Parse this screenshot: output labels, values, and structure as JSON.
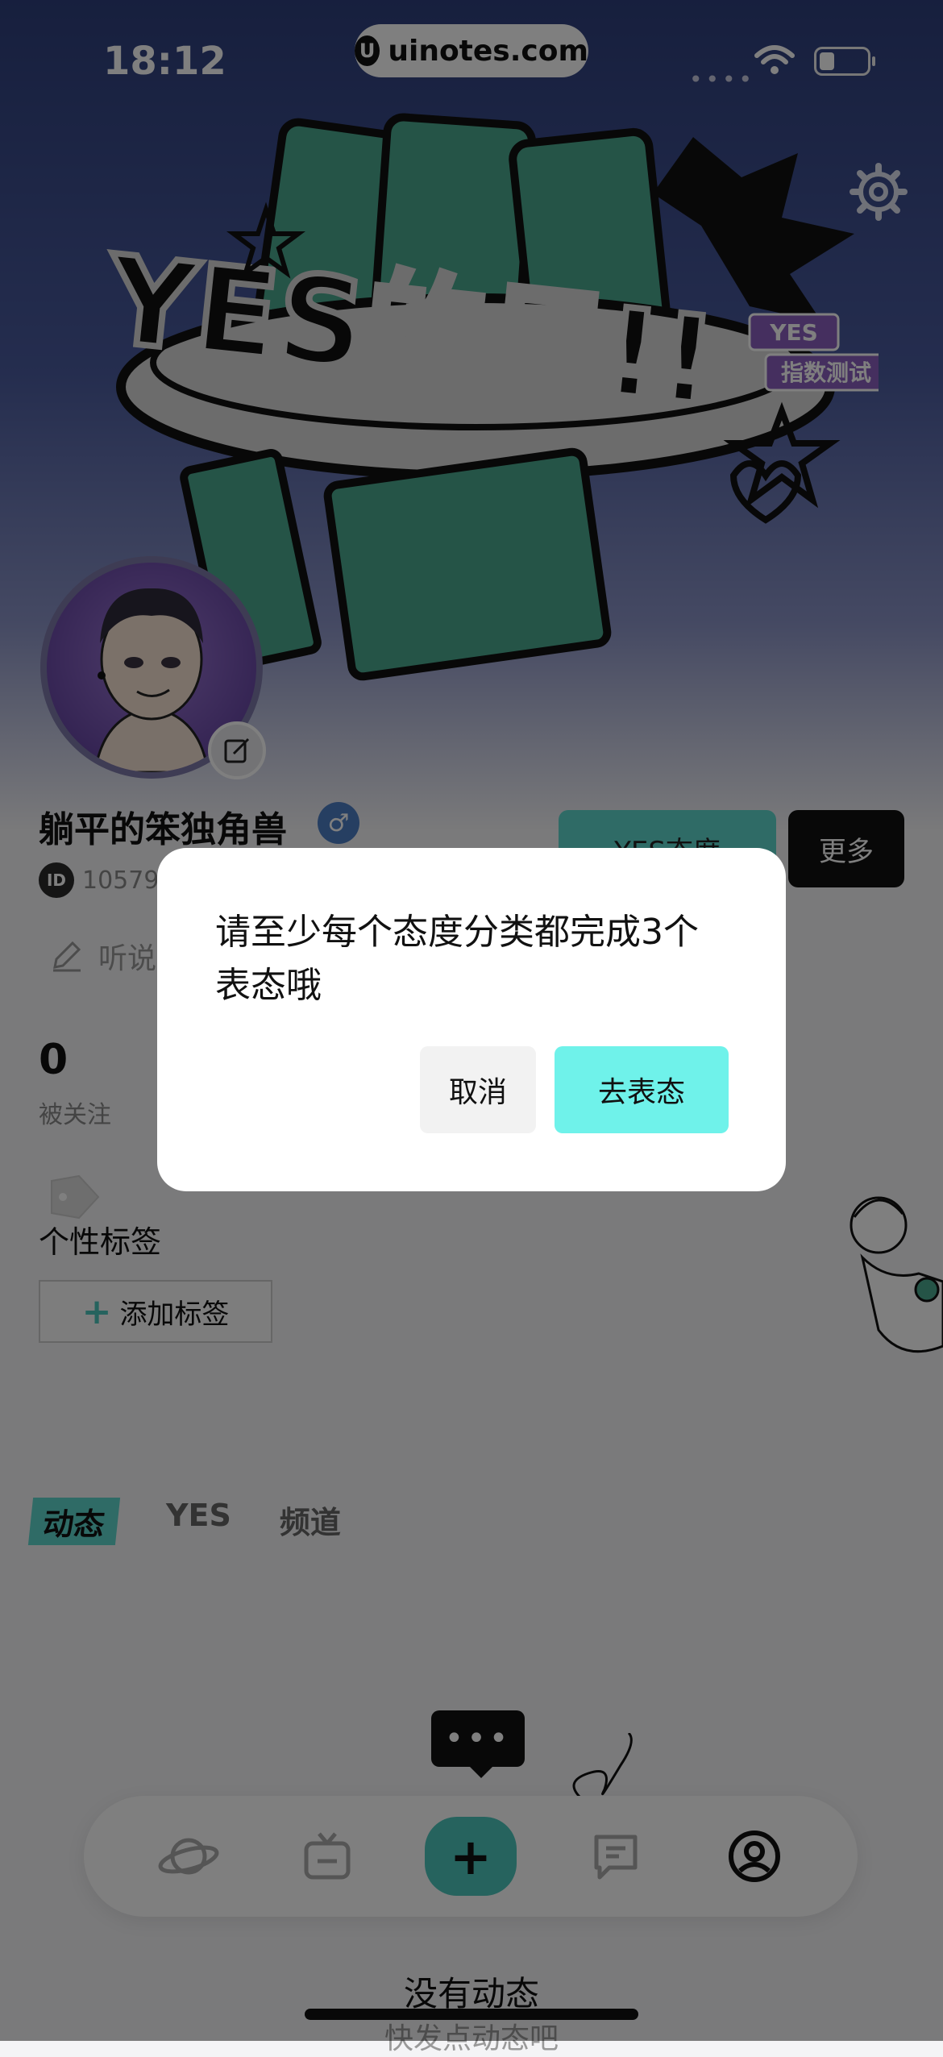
{
  "status_bar": {
    "time": "18:12",
    "url": "uinotes.com"
  },
  "sticker": {
    "main_text": "YES的尺!!",
    "badge_top": "YES",
    "badge_bottom": "指数测试"
  },
  "profile": {
    "name": "躺平的笨独角兽",
    "gender_symbol": "♂",
    "id_badge": "ID",
    "id_number": "10579",
    "bio_placeholder": "听说",
    "follower_count": "0",
    "follower_label": "被关注",
    "yes_button": "YES态度",
    "more_button": "更多"
  },
  "tags": {
    "title": "个性标签",
    "add_label": "添加标签"
  },
  "tabs": [
    {
      "label": "动态",
      "active": true
    },
    {
      "label": "YES",
      "active": false
    },
    {
      "label": "频道",
      "active": false
    }
  ],
  "chat_bubble": "•••",
  "empty": {
    "title": "没有动态",
    "subtitle": "快发点动态吧"
  },
  "nav": {
    "plus": "+",
    "items": [
      "planet-icon",
      "tv-icon",
      "add-icon",
      "message-icon",
      "profile-icon"
    ]
  },
  "dialog": {
    "message": "请至少每个态度分类都完成3个表态哦",
    "cancel": "取消",
    "confirm": "去表态"
  },
  "colors": {
    "accent": "#5fd6cd",
    "confirm": "#6ff2ea",
    "header_top": "#2e3f7c"
  }
}
